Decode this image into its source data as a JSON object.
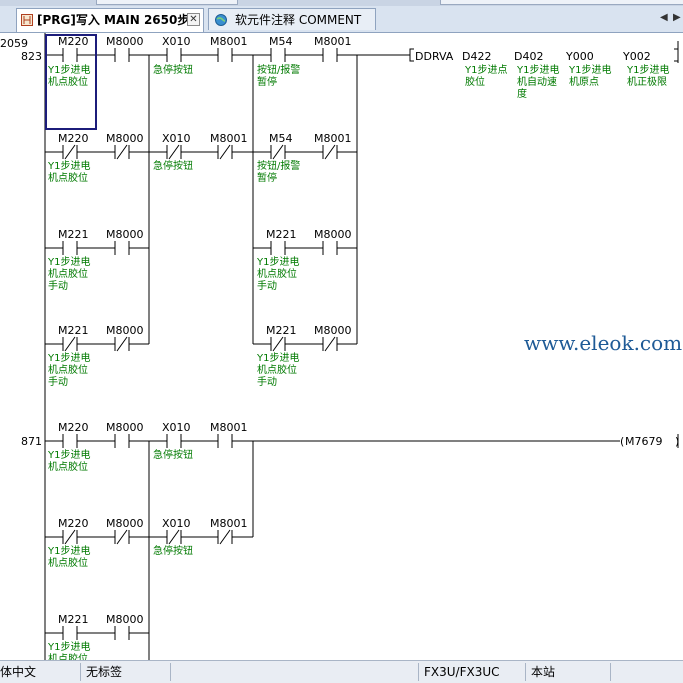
{
  "tabs": [
    {
      "label": "[PRG]写入 MAIN 2650步",
      "active": true
    },
    {
      "label": "软元件注释 COMMENT",
      "active": false
    }
  ],
  "nav": {
    "prev": "◀",
    "next": "▶"
  },
  "watermark": "www.eleok.com",
  "steps": {
    "top": "2059",
    "rung1": "823",
    "rung2": "871"
  },
  "contacts": {
    "M220": "M220",
    "M221": "M221",
    "M8000": "M8000",
    "X010": "X010",
    "M8001": "M8001",
    "M54": "M54"
  },
  "comments": {
    "m220_a": "Y1步进电",
    "m220_b": "机点胶位",
    "m221_a": "Y1步进电",
    "m221_b": "机点胶位",
    "m221_c": "手动",
    "x010": "急停按钮",
    "m54_a": "按钮/报警",
    "m54_b": "暂停"
  },
  "instruction": {
    "op": "DDRVA",
    "args": [
      {
        "name": "D422",
        "comment": [
          "Y1步进点",
          "胶位"
        ]
      },
      {
        "name": "D402",
        "comment": [
          "Y1步进电",
          "机自动速",
          "度"
        ]
      },
      {
        "name": "Y000",
        "comment": [
          "Y1步进电",
          "机原点"
        ]
      },
      {
        "name": "Y002",
        "comment": [
          "Y1步进电",
          "机正极限"
        ]
      }
    ]
  },
  "coil": {
    "label": "M7679"
  },
  "status": {
    "lang": "体中文",
    "tag": "无标签",
    "plc": "FX3U/FX3UC",
    "station": "本站"
  },
  "colors": {
    "comment": "#007a00",
    "watermark": "#1e5a96",
    "ladder": "#000000",
    "cursor": "#1c1c7a"
  }
}
